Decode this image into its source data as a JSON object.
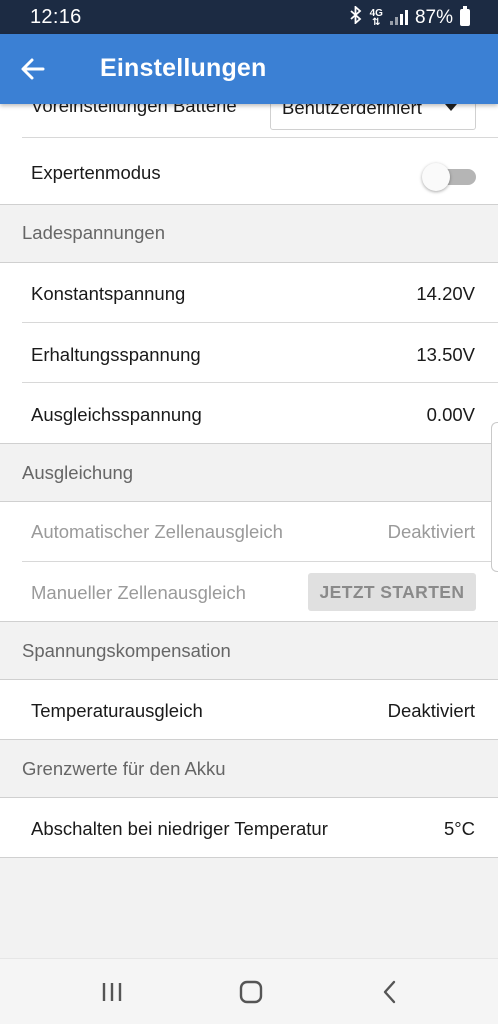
{
  "status_bar": {
    "time": "12:16",
    "network": "4G",
    "battery": "87%"
  },
  "app_bar": {
    "title": "Einstellungen"
  },
  "battery_preset": {
    "label": "Voreinstellungen Batterie",
    "value": "Benutzerdefiniert"
  },
  "expert_mode": {
    "label": "Expertenmodus",
    "enabled": false
  },
  "charge_voltages": {
    "header": "Ladespannungen",
    "items": [
      {
        "label": "Konstantspannung",
        "value": "14.20V"
      },
      {
        "label": "Erhaltungsspannung",
        "value": "13.50V"
      },
      {
        "label": "Ausgleichsspannung",
        "value": "0.00V"
      }
    ]
  },
  "equalization": {
    "header": "Ausgleichung",
    "auto": {
      "label": "Automatischer Zellenausgleich",
      "value": "Deaktiviert"
    },
    "manual": {
      "label": "Manueller Zellenausgleich",
      "button": "JETZT STARTEN"
    }
  },
  "voltage_compensation": {
    "header": "Spannungskompensation",
    "temp": {
      "label": "Temperaturausgleich",
      "value": "Deaktiviert"
    }
  },
  "battery_limits": {
    "header": "Grenzwerte für den Akku",
    "low_temp": {
      "label": "Abschalten bei niedriger Temperatur",
      "value": "5°C"
    }
  },
  "colors": {
    "status_bar": "#1c2b43",
    "app_bar": "#3b80d4",
    "background": "#f2f2f2"
  }
}
